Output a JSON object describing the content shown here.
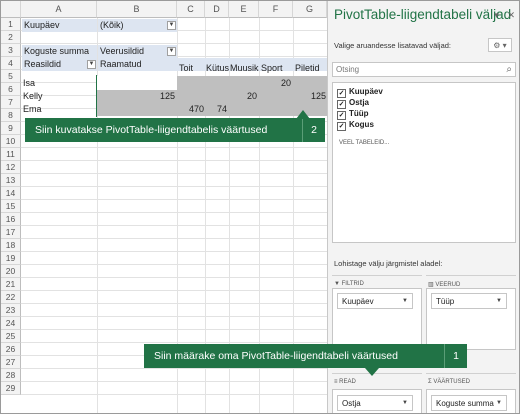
{
  "sheet": {
    "columns": [
      "A",
      "B",
      "C",
      "D",
      "E",
      "F",
      "G"
    ],
    "rows": [
      "1",
      "2",
      "3",
      "4",
      "5",
      "6",
      "7",
      "8",
      "9",
      "10",
      "11",
      "12",
      "13",
      "14",
      "15",
      "16",
      "17",
      "18",
      "19",
      "20",
      "21",
      "22",
      "23",
      "24",
      "25",
      "26",
      "27",
      "28",
      "29"
    ],
    "filter_field": "Kuupäev",
    "filter_value": "(Kõik)",
    "values_label": "Koguste summa",
    "col_labels_header": "Veerusildid",
    "row_labels_header": "Reasildid",
    "col_field": "Raamatud",
    "col_items": [
      "Toit",
      "Kütus",
      "Muusika",
      "Sport",
      "Piletid"
    ],
    "row_items": [
      "Isa",
      "Kelly",
      "Ema"
    ],
    "values": {
      "isa_sport": "20",
      "kelly_raamatud": "125",
      "kelly_muusika": "20",
      "kelly_piletid": "125",
      "ema_toit": "470",
      "ema_kutus": "74"
    }
  },
  "callouts": [
    {
      "text": "Siin kuvatakse PivotTable-liigendtabelis väärtused",
      "number": "2"
    },
    {
      "text": "Siin määrake oma PivotTable-liigendtabeli väärtused",
      "number": "1"
    }
  ],
  "pane": {
    "title": "PivotTable-liigendtabeli väljad",
    "subtitle": "Valige aruandesse lisatavad väljad:",
    "search_placeholder": "Otsing",
    "fields": [
      "Kuupäev",
      "Ostja",
      "Tüüp",
      "Kogus"
    ],
    "more_tables": "VEEL TABELEID...",
    "drag_label": "Lohistage välju järgmistel aladel:",
    "areas": {
      "filters": {
        "label": "FILTRID",
        "item": "Kuupäev"
      },
      "columns": {
        "label": "VEERUD",
        "item": "Tüüp"
      },
      "rows": {
        "label": "READ",
        "item": "Ostja"
      },
      "values": {
        "label": "VÄÄRTUSED",
        "item": "Koguste summa"
      }
    }
  }
}
